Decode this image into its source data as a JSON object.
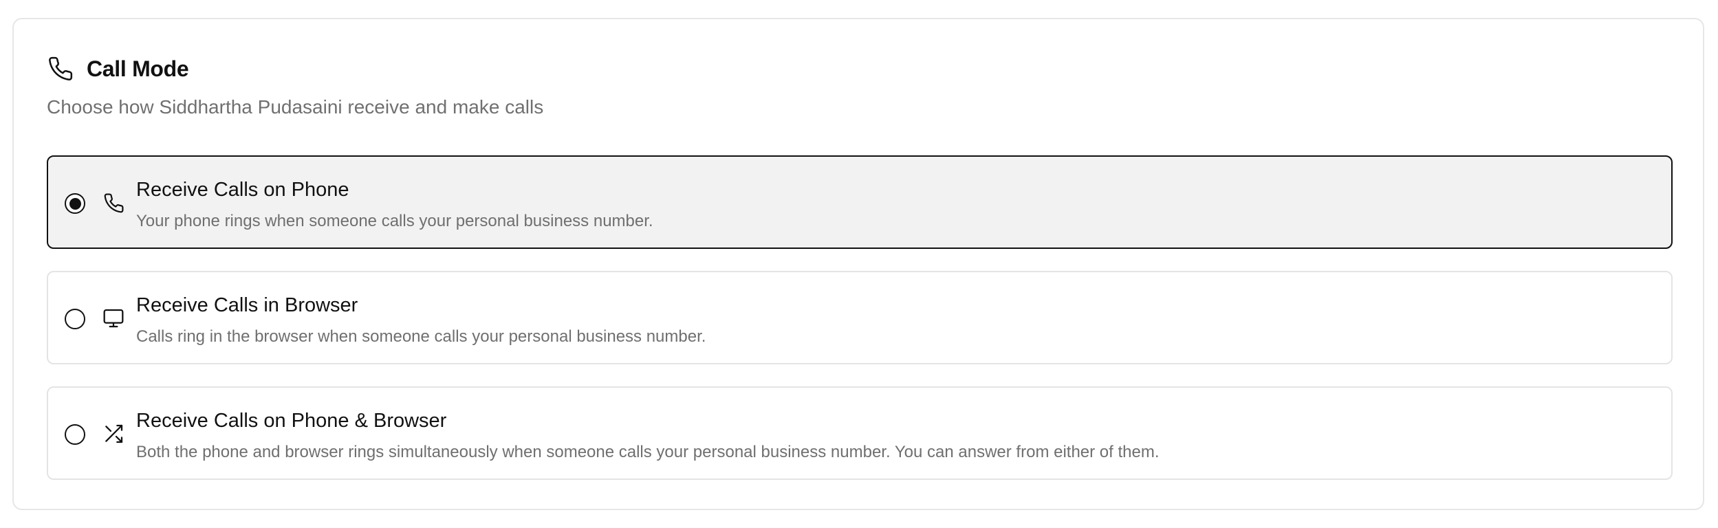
{
  "section": {
    "title": "Call Mode",
    "icon": "phone-icon",
    "subtitle": "Choose how Siddhartha Pudasaini receive and make calls"
  },
  "options": [
    {
      "title": "Receive Calls on Phone",
      "description": "Your phone rings when someone calls your personal business number.",
      "icon": "phone-icon",
      "selected": true
    },
    {
      "title": "Receive Calls in Browser",
      "description": "Calls ring in the browser when someone calls your personal business number.",
      "icon": "monitor-icon",
      "selected": false
    },
    {
      "title": "Receive Calls on Phone & Browser",
      "description": "Both the phone and browser rings simultaneously when someone calls your personal business number. You can answer from either of them.",
      "icon": "shuffle-icon",
      "selected": false
    }
  ],
  "colors": {
    "selected_background": "#f2f2f2",
    "selected_border": "#111111",
    "border": "#e4e4e4",
    "muted_text": "#707070"
  }
}
